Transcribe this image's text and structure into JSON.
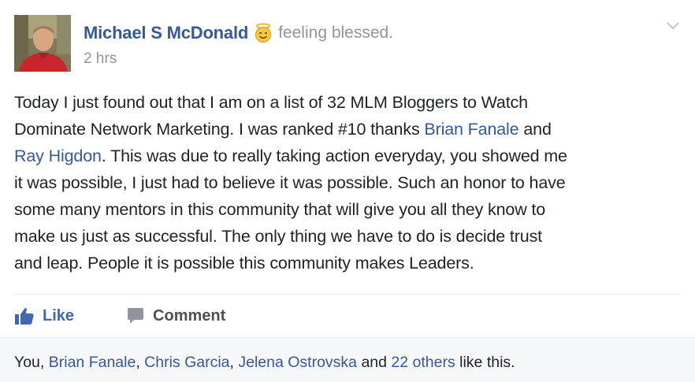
{
  "post": {
    "author": "Michael S McDonald",
    "feeling": "feeling blessed.",
    "feeling_icon": "smiling-halo-emoji-icon",
    "timestamp": "2 hrs",
    "menu_icon": "chevron-down-icon",
    "body": {
      "line1": "Today I just found out that I am on a list of 32 MLM Bloggers to Watch",
      "line2_a": "Dominate Network Marketing. I was ranked #10 thanks ",
      "line2_mention": "Brian Fanale",
      "line2_b": " and",
      "line3_mention": "Ray Higdon",
      "line3_b": ". This was due to really taking action everyday, you showed me",
      "line4": "it was possible, I just had to believe it was possible. Such an honor to have",
      "line5": "some many mentors in this community that will give you all they know to",
      "line6": "make us just as successful. The only thing we have to do is decide trust",
      "line7": "and leap. People it is possible this community makes Leaders."
    }
  },
  "actions": {
    "like_label": "Like",
    "comment_label": "Comment"
  },
  "likes": {
    "you": "You",
    "sep1": ", ",
    "friend1": "Brian Fanale",
    "sep2": ", ",
    "friend2": "Chris Garcia",
    "sep3": ", ",
    "friend3": "Jelena Ostrovska",
    "and": " and ",
    "others": "22 others",
    "suffix": " like this."
  },
  "colors": {
    "link": "#365899",
    "like_blue": "#4267b2",
    "meta_gray": "#90949c",
    "text": "#1d2129"
  }
}
